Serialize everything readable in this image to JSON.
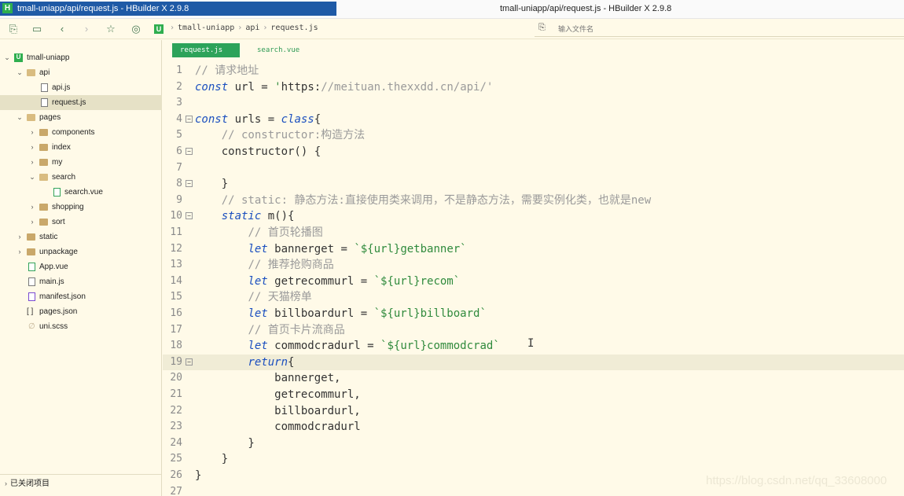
{
  "window": {
    "title_left": "tmall-uniapp/api/request.js - HBuilder X 2.9.8",
    "title_right": "tmall-uniapp/api/request.js - HBuilder X 2.9.8",
    "app_icon": "H"
  },
  "toolbar": {
    "icons": [
      "copy-icon",
      "save-icon",
      "back-icon",
      "forward-icon",
      "star-icon",
      "run-icon"
    ],
    "breadcrumb": [
      "tmall-uniapp",
      "api",
      "request.js"
    ],
    "project_icon": "U",
    "search_placeholder": "输入文件名"
  },
  "sidebar": {
    "items": [
      {
        "label": "tmall-uniapp",
        "expanded": true,
        "icon": "project-icon"
      },
      {
        "label": "api",
        "expanded": true,
        "icon": "folder-open-icon"
      },
      {
        "label": "api.js",
        "icon": "js-file-icon"
      },
      {
        "label": "request.js",
        "icon": "js-file-icon",
        "selected": true
      },
      {
        "label": "pages",
        "expanded": true,
        "icon": "folder-open-icon"
      },
      {
        "label": "components",
        "icon": "folder-icon"
      },
      {
        "label": "index",
        "icon": "folder-icon"
      },
      {
        "label": "my",
        "icon": "folder-icon"
      },
      {
        "label": "search",
        "expanded": true,
        "icon": "folder-open-icon"
      },
      {
        "label": "search.vue",
        "icon": "vue-file-icon"
      },
      {
        "label": "shopping",
        "icon": "folder-icon"
      },
      {
        "label": "sort",
        "icon": "folder-icon"
      },
      {
        "label": "static",
        "icon": "folder-icon"
      },
      {
        "label": "unpackage",
        "icon": "folder-icon"
      },
      {
        "label": "App.vue",
        "icon": "vue-file-icon"
      },
      {
        "label": "main.js",
        "icon": "js-file-icon"
      },
      {
        "label": "manifest.json",
        "icon": "json-file-icon"
      },
      {
        "label": "pages.json",
        "icon": "brackets-icon"
      },
      {
        "label": "uni.scss",
        "icon": "scss-file-icon"
      }
    ],
    "closed_projects": "已关闭项目"
  },
  "tabs": [
    {
      "label": "request.js",
      "active": true
    },
    {
      "label": "search.vue",
      "active": false
    }
  ],
  "editor": {
    "current_line": 19,
    "lines": [
      {
        "n": "1",
        "text": "// 请求地址"
      },
      {
        "n": "2",
        "text": "const url = 'https://meituan.thexxdd.cn/api/'"
      },
      {
        "n": "3",
        "text": ""
      },
      {
        "n": "4",
        "text": "const urls = class{",
        "fold": true
      },
      {
        "n": "5",
        "text": "    // constructor:构造方法"
      },
      {
        "n": "6",
        "text": "    constructor() {",
        "fold": true
      },
      {
        "n": "7",
        "text": ""
      },
      {
        "n": "8",
        "text": "    }",
        "fold": true
      },
      {
        "n": "9",
        "text": "    // static: 静态方法:直接使用类来调用，不是静态方法，需要实例化类，也就是new"
      },
      {
        "n": "10",
        "text": "    static m(){",
        "fold": true
      },
      {
        "n": "11",
        "text": "        // 首页轮播图"
      },
      {
        "n": "12",
        "text": "        let bannerget = `${url}getbanner`"
      },
      {
        "n": "13",
        "text": "        // 推荐抢购商品"
      },
      {
        "n": "14",
        "text": "        let getrecommurl = `${url}recom`"
      },
      {
        "n": "15",
        "text": "        // 天猫榜单"
      },
      {
        "n": "16",
        "text": "        let billboardurl = `${url}billboard`"
      },
      {
        "n": "17",
        "text": "        // 首页卡片流商品"
      },
      {
        "n": "18",
        "text": "        let commodcradurl = `${url}commodcrad`"
      },
      {
        "n": "19",
        "text": "        return{",
        "fold": true
      },
      {
        "n": "20",
        "text": "            bannerget,"
      },
      {
        "n": "21",
        "text": "            getrecommurl,"
      },
      {
        "n": "22",
        "text": "            billboardurl,"
      },
      {
        "n": "23",
        "text": "            commodcradurl"
      },
      {
        "n": "24",
        "text": "        }"
      },
      {
        "n": "25",
        "text": "    }"
      },
      {
        "n": "26",
        "text": "}"
      },
      {
        "n": "27",
        "text": ""
      }
    ]
  },
  "watermark": "https://blog.csdn.net/qq_33608000",
  "colors": {
    "background": "#fffae8",
    "keyword": "#1b4fbf",
    "comment": "#9a9a9a",
    "string": "#2f8a3c",
    "tab_active": "#2ca35a",
    "title_bar_active": "#1f5aa6"
  }
}
